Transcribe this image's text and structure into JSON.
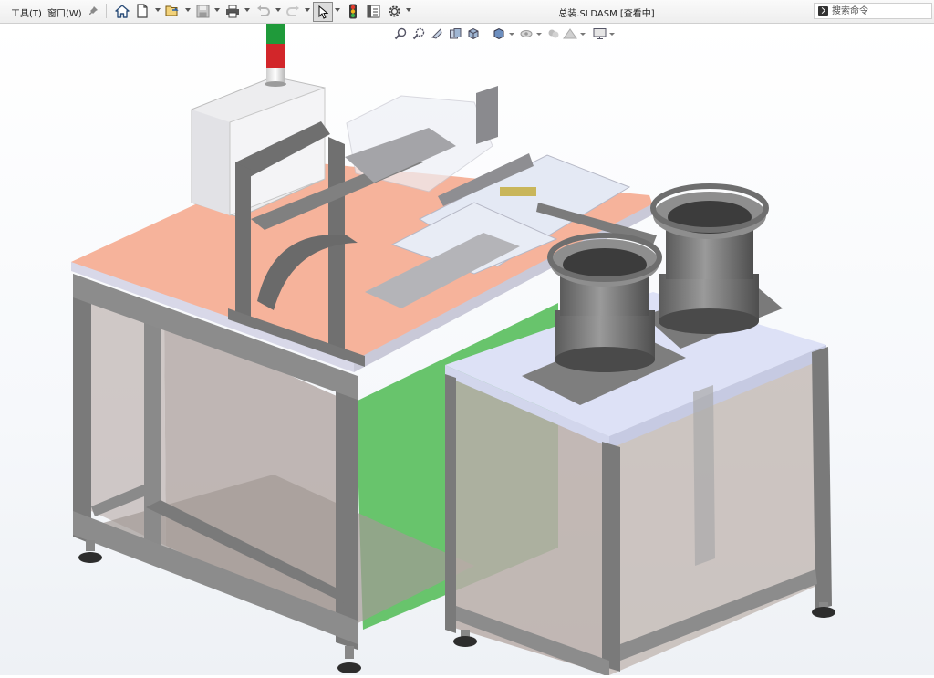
{
  "menu": {
    "tools": "工具(T)",
    "window": "窗口(W)"
  },
  "document": {
    "title": "总装.SLDASM [查看中]"
  },
  "search": {
    "placeholder": "搜索命令"
  },
  "colors": {
    "table_top": "#f7b8a0",
    "frame": "#7a7a7a",
    "panel_green": "#66c26a",
    "panel_glass": "#b9aeaa",
    "feeder_top": "#dde1f6",
    "cabinet": "#ececee",
    "beacon_green": "#1f9a3a",
    "beacon_red": "#d2262a"
  },
  "icons": {
    "toolbar": [
      "pin-icon",
      "home-icon",
      "new-document-icon",
      "open-folder-icon",
      "save-icon",
      "print-icon",
      "undo-icon",
      "redo-icon",
      "select-pointer-icon",
      "traffic-light-icon",
      "file-properties-icon",
      "options-gear-icon"
    ],
    "heads_up": [
      "zoom-to-fit-icon",
      "zoom-to-area-icon",
      "previous-view-icon",
      "section-view-icon",
      "view-orientation-icon",
      "display-style-icon",
      "hide-show-items-icon",
      "edit-appearance-icon",
      "apply-scene-icon",
      "view-settings-icon"
    ]
  }
}
